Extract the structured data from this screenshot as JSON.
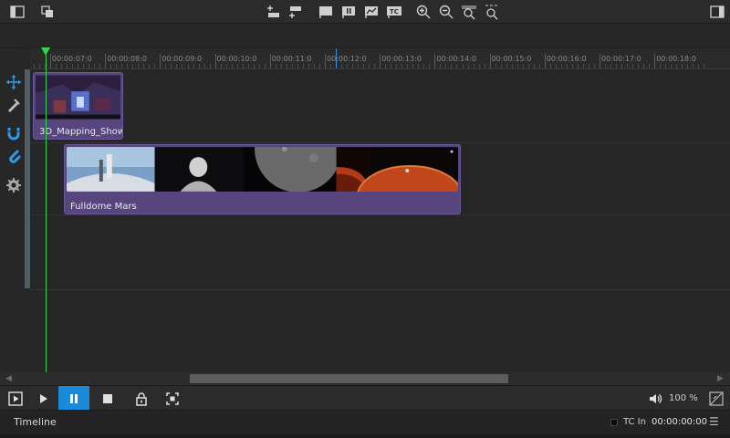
{
  "toolbar": {
    "icons": [
      "sidebar-left-icon",
      "copy-icon",
      "add-track-above-icon",
      "add-track-below-icon",
      "marker-flag-icon",
      "marker-pause-icon",
      "marker-graph-icon",
      "marker-tc-icon",
      "zoom-in-icon",
      "zoom-out-icon",
      "zoom-fit-icon",
      "zoom-custom-icon",
      "sidebar-right-icon"
    ],
    "tc_badge": "TC"
  },
  "tools": [
    "move-icon",
    "razor-icon",
    "magnet-icon",
    "snap-icon",
    "settings-icon"
  ],
  "ruler": {
    "ticks": [
      "00:00:07:0",
      "00:00:08:0",
      "00:00:09:0",
      "00:00:10:0",
      "00:00:11:0",
      "00:00:12:0",
      "00:00:13:0",
      "00:00:14:0",
      "00:00:15:0",
      "00:00:16:0",
      "00:00:17:0",
      "00:00:18:0"
    ]
  },
  "clips": [
    {
      "label": "3D_Mapping_Show"
    },
    {
      "label": "Fulldome Mars"
    }
  ],
  "transport": {
    "volume": "100 %",
    "buttons": [
      "play-from-start-icon",
      "play-icon",
      "pause-icon",
      "stop-icon",
      "lock-icon",
      "focus-icon",
      "volume-icon",
      "timecode-toggle-icon"
    ]
  },
  "status": {
    "panel_title": "Timeline",
    "tc_label": "TC In",
    "tc_value": "00:00:00:00"
  },
  "colors": {
    "clip": "#57457d",
    "playhead": "#33d64a",
    "accent": "#1b8ad8"
  }
}
